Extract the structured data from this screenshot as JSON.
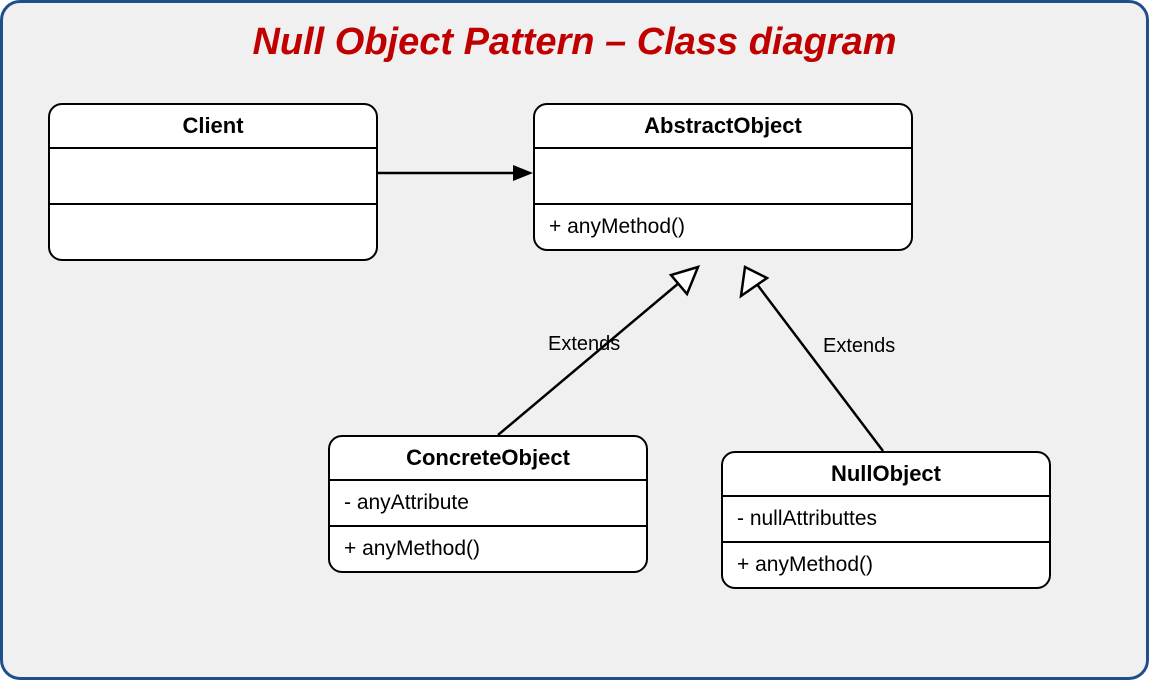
{
  "title": "Null Object Pattern – Class diagram",
  "classes": {
    "client": {
      "name": "Client",
      "attrs": "",
      "methods": ""
    },
    "abstract": {
      "name": "AbstractObject",
      "attrs": "",
      "methods": "+ anyMethod()"
    },
    "concrete": {
      "name": "ConcreteObject",
      "attrs": "- anyAttribute",
      "methods": "+ anyMethod()"
    },
    "nullobj": {
      "name": "NullObject",
      "attrs": "- nullAttributtes",
      "methods": "+ anyMethod()"
    }
  },
  "relations": {
    "clientToAbstract": {
      "type": "association"
    },
    "concreteExtends": {
      "label": "Extends",
      "type": "inheritance"
    },
    "nullExtends": {
      "label": "Extends",
      "type": "inheritance"
    }
  }
}
